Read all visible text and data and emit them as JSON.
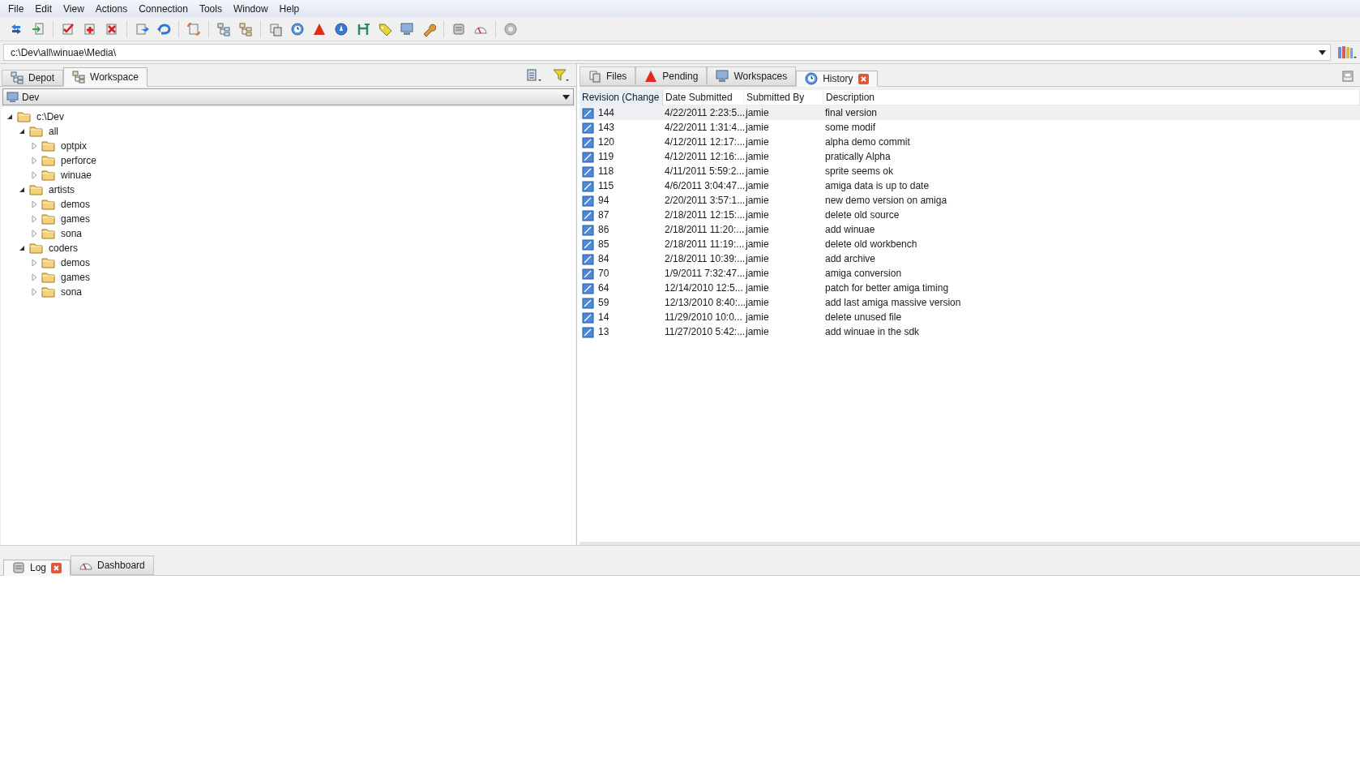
{
  "menu": [
    "File",
    "Edit",
    "View",
    "Actions",
    "Connection",
    "Tools",
    "Window",
    "Help"
  ],
  "address": {
    "value": "c:\\Dev\\all\\winuae\\Media\\"
  },
  "left_tabs": [
    {
      "label": "Depot",
      "selected": false
    },
    {
      "label": "Workspace",
      "selected": true
    }
  ],
  "workspace_dropdown": {
    "value": "Dev"
  },
  "tree": [
    {
      "label": "c:\\Dev",
      "expanded": true,
      "children": [
        {
          "label": "all",
          "expanded": true,
          "children": [
            {
              "label": "optpix",
              "expanded": false
            },
            {
              "label": "perforce",
              "expanded": false
            },
            {
              "label": "winuae",
              "expanded": false
            }
          ]
        },
        {
          "label": "artists",
          "expanded": true,
          "children": [
            {
              "label": "demos",
              "expanded": false
            },
            {
              "label": "games",
              "expanded": false
            },
            {
              "label": "sona",
              "expanded": false
            }
          ]
        },
        {
          "label": "coders",
          "expanded": true,
          "children": [
            {
              "label": "demos",
              "expanded": false
            },
            {
              "label": "games",
              "expanded": false
            },
            {
              "label": "sona",
              "expanded": false
            }
          ]
        }
      ]
    }
  ],
  "right_tabs": [
    {
      "label": "Files",
      "selected": false,
      "closable": false
    },
    {
      "label": "Pending",
      "selected": false,
      "closable": false
    },
    {
      "label": "Workspaces",
      "selected": false,
      "closable": false
    },
    {
      "label": "History",
      "selected": true,
      "closable": true
    }
  ],
  "history": {
    "columns": [
      "Revision (Change",
      "Date Submitted",
      "Submitted By",
      "Description"
    ],
    "rows": [
      {
        "revision": "144",
        "date": "4/22/2011 2:23:5...",
        "user": "jamie",
        "description": "final version",
        "selected": true
      },
      {
        "revision": "143",
        "date": "4/22/2011 1:31:4...",
        "user": "jamie",
        "description": "some modif",
        "selected": false
      },
      {
        "revision": "120",
        "date": "4/12/2011 12:17:...",
        "user": "jamie",
        "description": "alpha demo commit",
        "selected": false
      },
      {
        "revision": "119",
        "date": "4/12/2011 12:16:...",
        "user": "jamie",
        "description": "pratically Alpha",
        "selected": false
      },
      {
        "revision": "118",
        "date": "4/11/2011 5:59:2...",
        "user": "jamie",
        "description": "sprite seems ok",
        "selected": false
      },
      {
        "revision": "115",
        "date": "4/6/2011 3:04:47...",
        "user": "jamie",
        "description": "amiga data is up to date",
        "selected": false
      },
      {
        "revision": "94",
        "date": "2/20/2011 3:57:1...",
        "user": "jamie",
        "description": "new demo version on amiga",
        "selected": false
      },
      {
        "revision": "87",
        "date": "2/18/2011 12:15:...",
        "user": "jamie",
        "description": "delete old source",
        "selected": false
      },
      {
        "revision": "86",
        "date": "2/18/2011 11:20:...",
        "user": "jamie",
        "description": "add winuae",
        "selected": false
      },
      {
        "revision": "85",
        "date": "2/18/2011 11:19:...",
        "user": "jamie",
        "description": "delete old workbench",
        "selected": false
      },
      {
        "revision": "84",
        "date": "2/18/2011 10:39:...",
        "user": "jamie",
        "description": "add archive",
        "selected": false
      },
      {
        "revision": "70",
        "date": "1/9/2011 7:32:47...",
        "user": "jamie",
        "description": "amiga conversion",
        "selected": false
      },
      {
        "revision": "64",
        "date": "12/14/2010 12:5...",
        "user": "jamie",
        "description": "patch for better amiga timing",
        "selected": false
      },
      {
        "revision": "59",
        "date": "12/13/2010 8:40:...",
        "user": "jamie",
        "description": "add last amiga massive version",
        "selected": false
      },
      {
        "revision": "14",
        "date": "11/29/2010 10:0...",
        "user": "jamie",
        "description": "delete unused file",
        "selected": false
      },
      {
        "revision": "13",
        "date": "11/27/2010 5:42:...",
        "user": "jamie",
        "description": "add winuae in the sdk",
        "selected": false
      }
    ]
  },
  "bottom_tabs": [
    {
      "label": "Log",
      "selected": true,
      "closable": true
    },
    {
      "label": "Dashboard",
      "selected": false,
      "closable": false
    }
  ]
}
